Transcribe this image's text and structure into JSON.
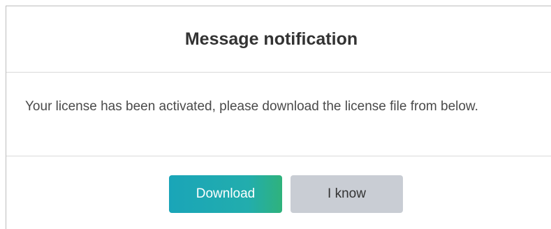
{
  "dialog": {
    "title": "Message notification",
    "message": "Your license has been activated, please download the license file from below.",
    "buttons": {
      "download_label": "Download",
      "know_label": "I know"
    }
  },
  "colors": {
    "primary_start": "#1aa5b8",
    "primary_end": "#2fb27c",
    "secondary": "#c9cdd4",
    "title_text": "#333333"
  }
}
